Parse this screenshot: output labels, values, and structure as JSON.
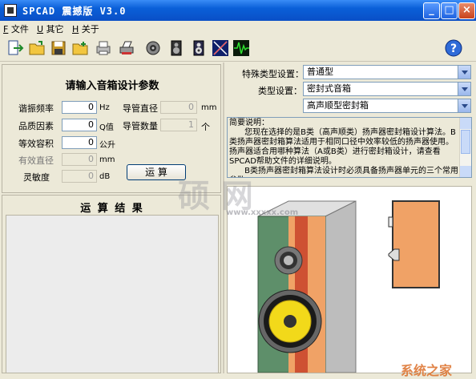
{
  "window": {
    "title": "SPCAD 震撼版 V3.0",
    "min": "_",
    "max": "□",
    "close": "×"
  },
  "menu": [
    {
      "key": "F",
      "label": "文件"
    },
    {
      "key": "U",
      "label": "其它"
    },
    {
      "key": "H",
      "label": "关于"
    }
  ],
  "toolbar_icons": [
    "exit-icon",
    "open-folder-icon",
    "save-icon",
    "folder-icon",
    "print-icon",
    "printer-icon",
    "speaker-icon",
    "speaker-box-icon",
    "speaker-box-2-icon",
    "crossover-icon",
    "waveform-icon",
    "help-icon"
  ],
  "input": {
    "title": "请输入音箱设计参数",
    "resonance": {
      "label": "谐振频率",
      "value": "0",
      "unit": "Hz"
    },
    "q": {
      "label": "品质因素",
      "value": "0",
      "unit": "Q值"
    },
    "volume": {
      "label": "等效容积",
      "value": "0",
      "unit": "公升"
    },
    "diameter": {
      "label": "有效直径",
      "value": "0",
      "unit": "mm"
    },
    "sensitivity": {
      "label": "灵敏度",
      "value": "0",
      "unit": "dB"
    },
    "port_diameter": {
      "label": "导管直径",
      "value": "0",
      "unit": "mm"
    },
    "port_count": {
      "label": "导管数量",
      "value": "1",
      "unit": "个"
    },
    "calc_button": "运 算"
  },
  "result": {
    "title": "运 算 结 果"
  },
  "settings": {
    "special_label": "特殊类型设置：",
    "special_value": "普通型",
    "type_label": "类型设置：",
    "type_value": "密封式音箱",
    "sub_value": "高声顺型密封箱"
  },
  "description": "简要说明：\n      您现在选择的是B类（高声顺类）扬声器密封箱设计算法。B类扬声器密封箱算法适用于相同口径中效率较低的扬声器使用。扬声器适合用哪种算法（A或B类）进行密封箱设计，请查看SPCAD帮助文件的详细说明。\n      B类扬声器密封箱算法设计时必须具备扬声器单元的三个常用参数：",
  "watermark": {
    "main": "硕 网",
    "url": "www.xxxxx.com",
    "bottom": "系统之家"
  },
  "colors": {
    "titlebar": "#0a5fd8",
    "panel": "#ece9d8",
    "box_green": "#5e8f6a",
    "box_orange": "#f0a266",
    "box_red": "#c8432a",
    "woofer_yellow": "#f2d91a"
  }
}
